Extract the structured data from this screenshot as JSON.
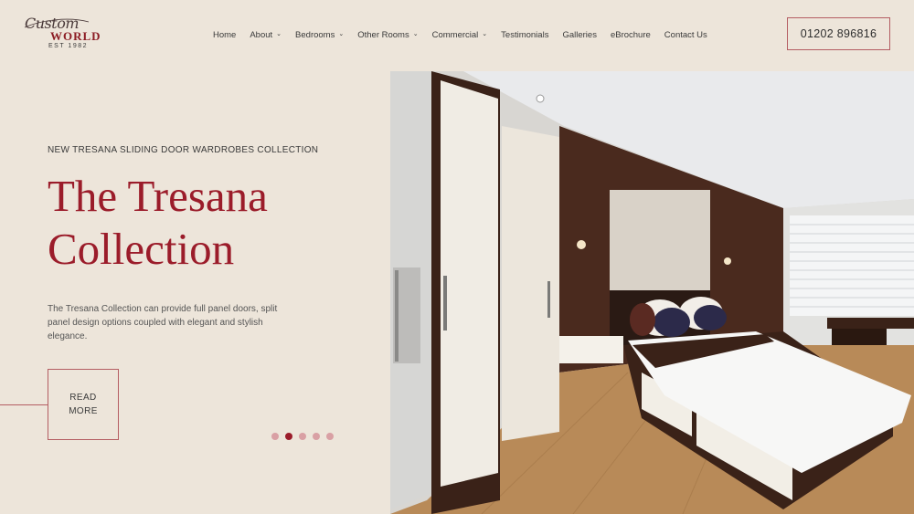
{
  "brand": {
    "script": "Custom",
    "world": "WORLD",
    "est": "EST 1982",
    "accent_color": "#9b1c2a"
  },
  "nav": {
    "items": [
      {
        "label": "Home",
        "has_dropdown": false
      },
      {
        "label": "About",
        "has_dropdown": true
      },
      {
        "label": "Bedrooms",
        "has_dropdown": true
      },
      {
        "label": "Other Rooms",
        "has_dropdown": true
      },
      {
        "label": "Commercial",
        "has_dropdown": true
      },
      {
        "label": "Testimonials",
        "has_dropdown": false
      },
      {
        "label": "Galleries",
        "has_dropdown": false
      },
      {
        "label": "eBrochure",
        "has_dropdown": false
      },
      {
        "label": "Contact Us",
        "has_dropdown": false
      }
    ],
    "caret": "⌄"
  },
  "header": {
    "phone": "01202 896816"
  },
  "hero": {
    "eyebrow": "NEW TRESANA SLIDING DOOR WARDROBES COLLECTION",
    "title_line1": "The Tresana",
    "title_line2": "Collection",
    "description": "The Tresana Collection can provide full panel doors, split panel design options coupled with elegant and stylish elegance.",
    "cta_line1": "READ",
    "cta_line2": "MORE"
  },
  "carousel": {
    "slide_count": 5,
    "active_index": 1
  },
  "colors": {
    "background": "#ede5da",
    "accent": "#9b1c2a",
    "border": "#b45d62",
    "inactive_dot": "#d9a0a4"
  }
}
